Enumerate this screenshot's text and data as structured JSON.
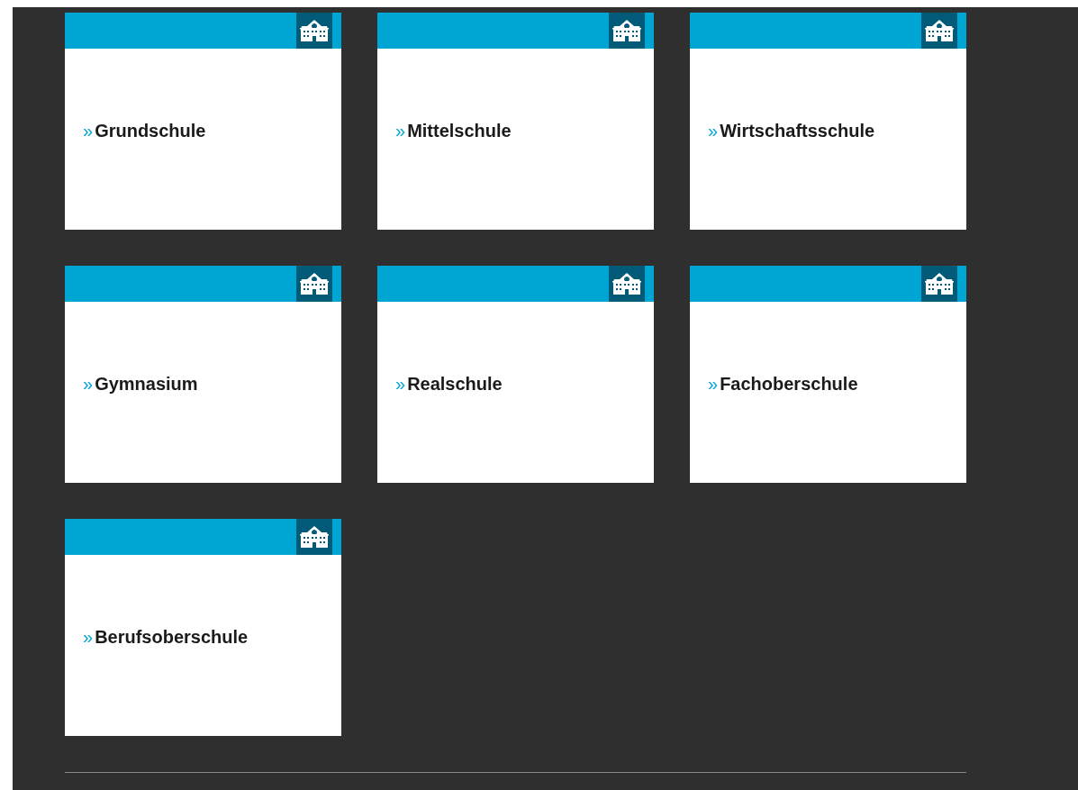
{
  "cards": [
    {
      "marker": "»",
      "label": "Grundschule"
    },
    {
      "marker": "»",
      "label": "Mittelschule"
    },
    {
      "marker": "»",
      "label": "Wirtschaftsschule"
    },
    {
      "marker": "»",
      "label": "Gymnasium"
    },
    {
      "marker": "»",
      "label": "Realschule"
    },
    {
      "marker": "»",
      "label": "Fachoberschule"
    },
    {
      "marker": "»",
      "label": "Berufsoberschule"
    }
  ]
}
